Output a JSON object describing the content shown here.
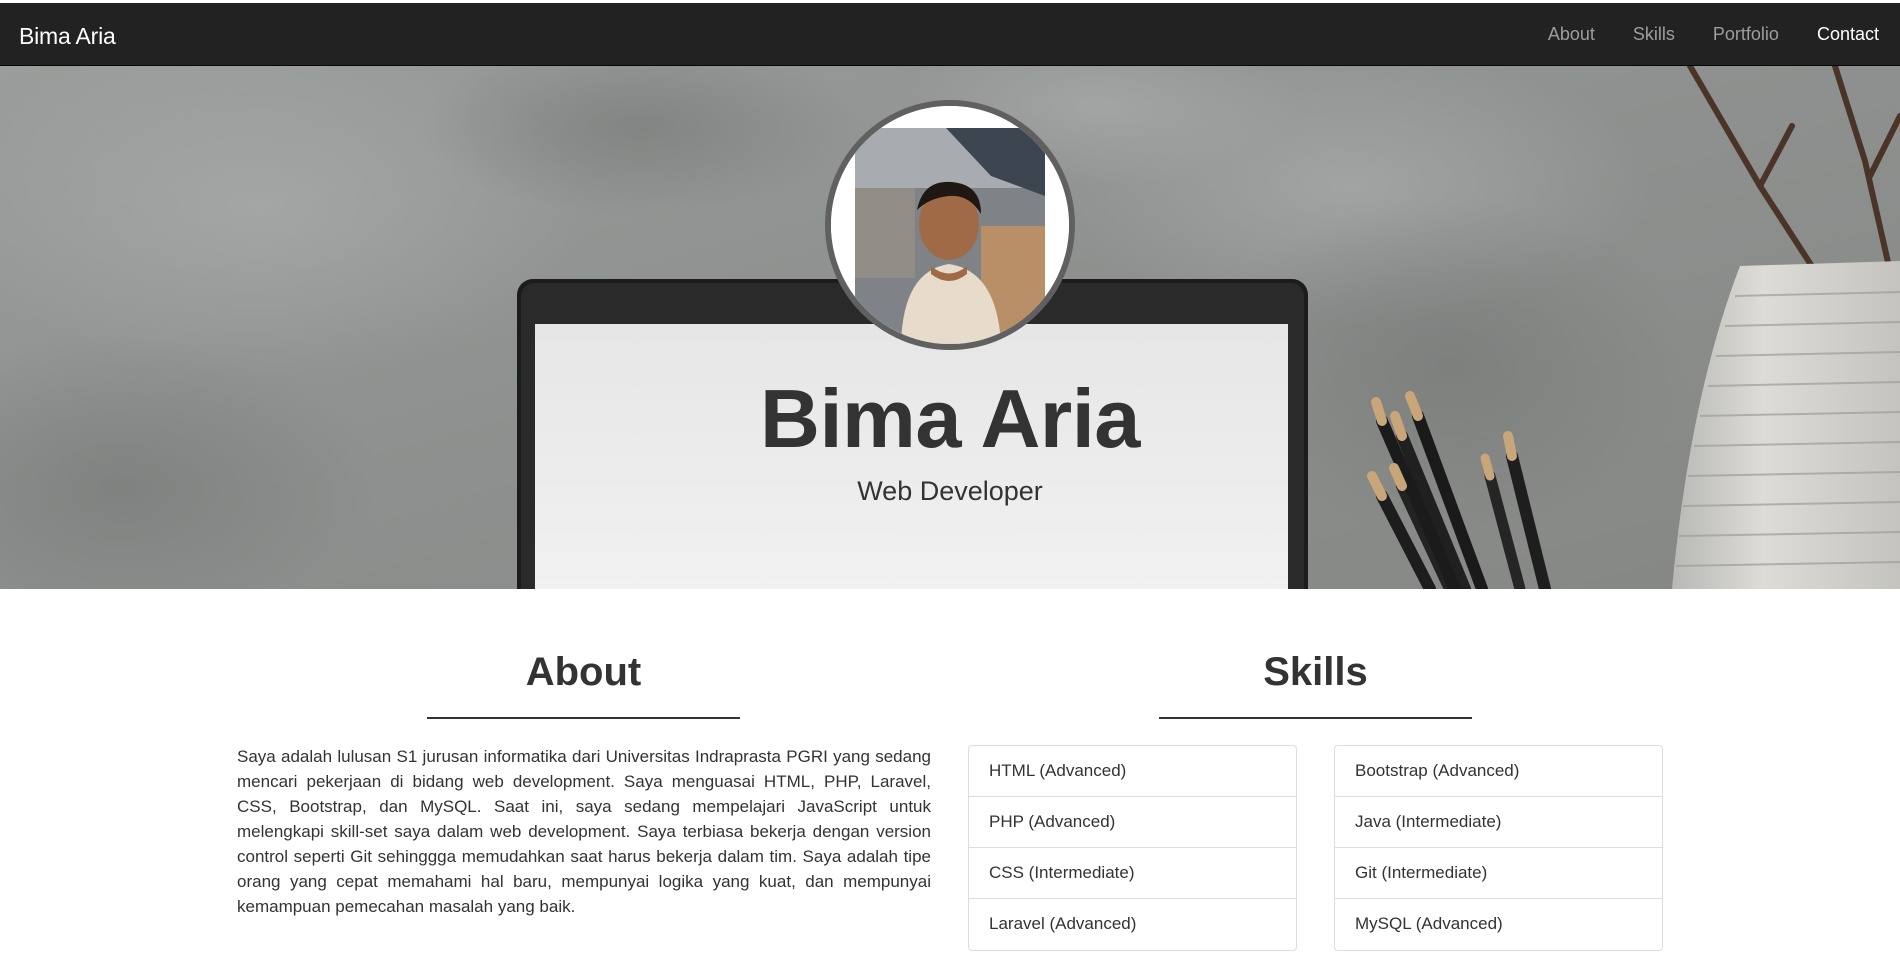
{
  "nav": {
    "brand": "Bima Aria",
    "links": [
      {
        "label": "About"
      },
      {
        "label": "Skills"
      },
      {
        "label": "Portfolio"
      },
      {
        "label": "Contact"
      }
    ]
  },
  "hero": {
    "name": "Bima Aria",
    "title": "Web Developer"
  },
  "about": {
    "heading": "About",
    "text": "Saya adalah lulusan S1 jurusan informatika dari Universitas Indraprasta PGRI yang sedang mencari pekerjaan di bidang web development. Saya menguasai HTML, PHP, Laravel, CSS, Bootstrap, dan MySQL. Saat ini, saya sedang mempelajari JavaScript untuk melengkapi skill-set saya dalam web development. Saya terbiasa bekerja dengan version control seperti Git sehinggga memudahkan saat harus bekerja dalam tim. Saya adalah tipe orang yang cepat memahami hal baru, mempunyai logika yang kuat, dan mempunyai kemampuan pemecahan masalah yang baik."
  },
  "skills": {
    "heading": "Skills",
    "left": [
      "HTML (Advanced)",
      "PHP (Advanced)",
      "CSS (Intermediate)",
      "Laravel (Advanced)"
    ],
    "right": [
      "Bootstrap (Advanced)",
      "Java (Intermediate)",
      "Git (Intermediate)",
      "MySQL (Advanced)"
    ]
  },
  "colors": {
    "navbar": "#222222",
    "nav_link": "#9d9d9d",
    "nav_link_active": "#ffffff",
    "text": "#333333"
  }
}
